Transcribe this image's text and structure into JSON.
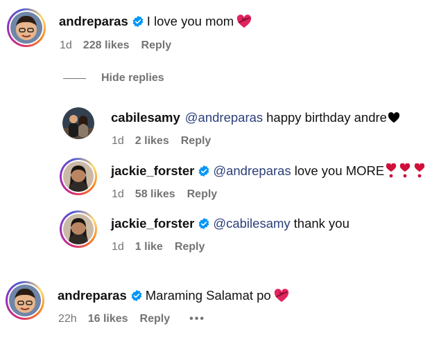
{
  "comments": [
    {
      "username": "andreparas",
      "verified": true,
      "text": "I love you mom",
      "emoji": "heart-with-ribbon",
      "time": "1d",
      "likes": "228 likes",
      "reply": "Reply"
    },
    {
      "username": "cabilesamy",
      "verified": false,
      "mention": "@andreparas",
      "text": "happy birthday andre",
      "emoji": "black-heart",
      "time": "1d",
      "likes": "2 likes",
      "reply": "Reply"
    },
    {
      "username": "jackie_forster",
      "verified": true,
      "mention": "@andreparas",
      "text": "love you MORE",
      "emoji": "heart-exclamation-x3",
      "time": "1d",
      "likes": "58 likes",
      "reply": "Reply"
    },
    {
      "username": "jackie_forster",
      "verified": true,
      "mention": "@cabilesamy",
      "text": "thank you",
      "time": "1d",
      "likes": "1 like",
      "reply": "Reply"
    },
    {
      "username": "andreparas",
      "verified": true,
      "text": "Maraming Salamat po",
      "emoji": "heart-with-ribbon",
      "time": "22h",
      "likes": "16 likes",
      "reply": "Reply",
      "more": "•••"
    }
  ],
  "thread": {
    "hide_replies": "Hide replies"
  },
  "colors": {
    "verified": "#0095f6",
    "meta": "#737373",
    "mention": "#2b3f7a",
    "heart": "#e0245e"
  },
  "icons": {
    "verified": "verified-badge-icon",
    "heart_ribbon": "heart-with-ribbon-icon",
    "black_heart": "black-heart-icon",
    "heart_exclamation": "heart-exclamation-icon",
    "more": "more-options-icon"
  }
}
